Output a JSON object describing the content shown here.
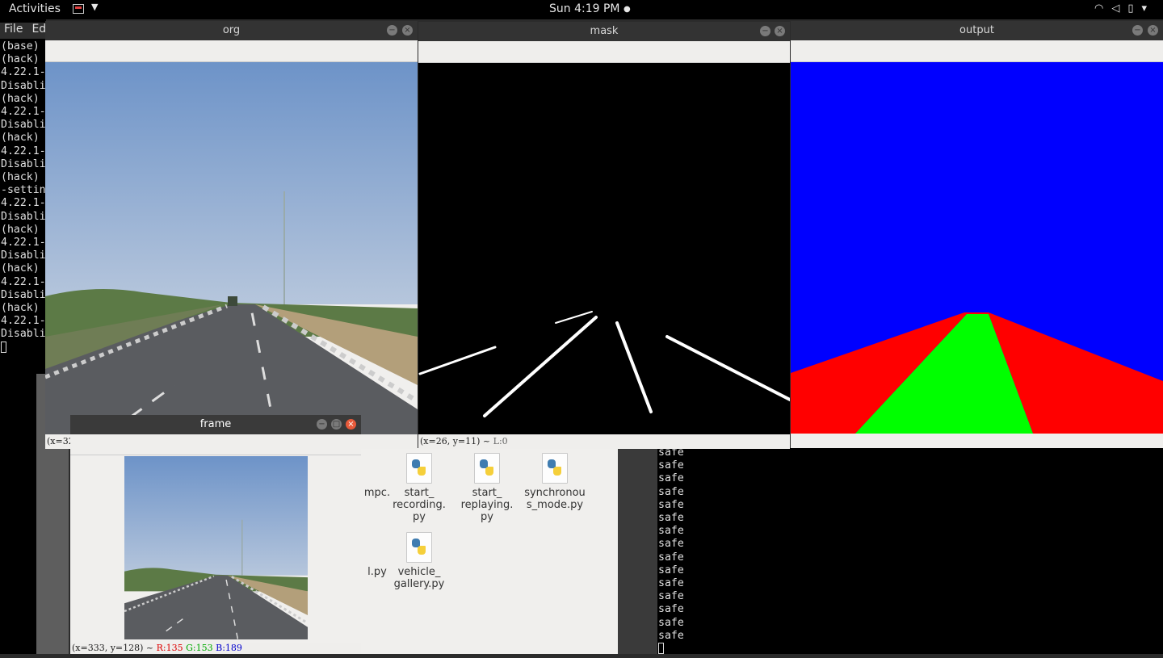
{
  "topbar": {
    "activities": "Activities",
    "clock": "Sun  4:19 PM",
    "clock_dot": "●",
    "tray_icons": [
      "wifi-icon",
      "volume-muted-icon",
      "battery-icon",
      "system-menu-caret"
    ]
  },
  "terminal_left": {
    "menu": [
      "File",
      "Edi"
    ],
    "lines": [
      "(base)",
      "(hack)",
      "4.22.1-",
      "Disabli",
      "(hack)",
      "4.22.1-",
      "Disabli",
      "(hack)",
      "4.22.1-",
      "Disabli",
      "(hack)",
      "-settin",
      "4.22.1-",
      "Disabli",
      "(hack)",
      "4.22.1-",
      "Disabli",
      "(hack)",
      "4.22.1-",
      "Disabli",
      "(hack)",
      "4.22.1-",
      "Disabli"
    ]
  },
  "windows": {
    "org": {
      "title": "org",
      "status": "(x=32"
    },
    "mask": {
      "title": "mask",
      "status_pos": "(x=26, y=11) ~ ",
      "status_l": "L:0"
    },
    "output": {
      "title": "output"
    },
    "frame": {
      "title": "frame",
      "status_pos": "(x=333, y=128) ~ ",
      "r": "R:135",
      "g": "G:153",
      "b": "B:189"
    }
  },
  "file_manager": {
    "files": [
      {
        "name": "mpc.",
        "partial": true
      },
      {
        "name": "start_\nrecording.\npy"
      },
      {
        "name": "start_\nreplaying.\npy"
      },
      {
        "name": "synchronou\ns_mode.py"
      },
      {
        "name": "l.py",
        "partial": true
      },
      {
        "name": "vehicle_\ngallery.py"
      }
    ]
  },
  "terminal_right": {
    "lines": [
      "safe",
      "safe",
      "safe",
      "safe",
      "safe",
      "safe",
      "safe",
      "safe",
      "safe",
      "safe",
      "safe",
      "safe",
      "safe",
      "safe",
      "safe"
    ]
  },
  "colors": {
    "output_sky": "#0000ff",
    "output_road": "#00ff00",
    "output_side": "#ff0000"
  }
}
